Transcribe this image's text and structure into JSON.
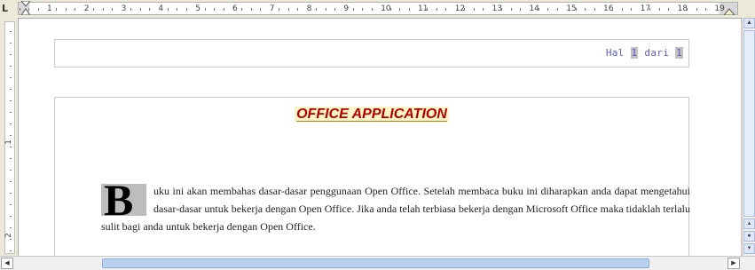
{
  "ruler": {
    "numbers": [
      "1",
      "2",
      "3",
      "4",
      "5",
      "6",
      "7",
      "8",
      "9",
      "10",
      "11",
      "12",
      "13",
      "14",
      "15",
      "16",
      "17",
      "18",
      "19"
    ],
    "vertical_numbers": [
      "1",
      "2"
    ]
  },
  "header": {
    "prefix": "Hal",
    "page": "1",
    "middle": "dari",
    "total": "1"
  },
  "document": {
    "title": "OFFICE APPLICATION",
    "drop_cap": "B",
    "paragraph": "uku ini akan membahas dasar-dasar penggunaan Open Office. Setelah membaca buku ini diharapkan anda dapat mengetahui dasar-dasar untuk bekerja dengan Open Office. Jika anda telah terbiasa bekerja dengan Microsoft Office maka tidaklah terlalu sulit bagi anda untuk bekerja dengan Open Office."
  },
  "colors": {
    "title": "#b00000",
    "header_text": "#5a5ac8",
    "scroll_thumb": "#b9d0ee"
  }
}
